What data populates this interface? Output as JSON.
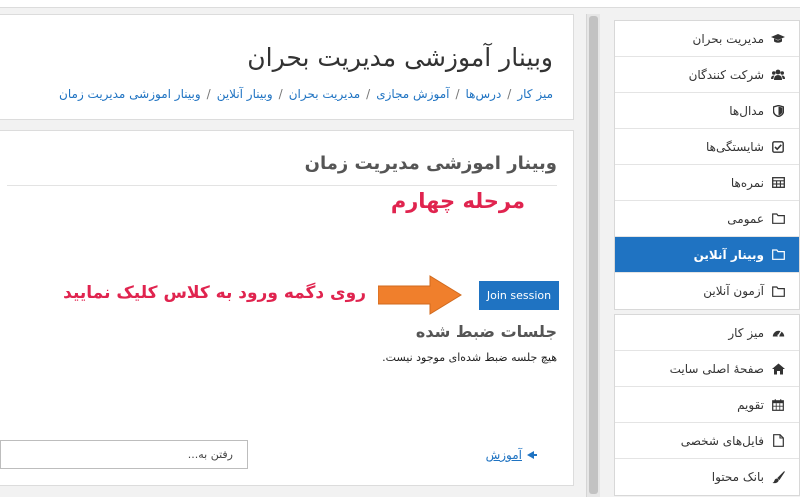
{
  "header": {
    "title": "وبینار آموزشی مدیریت بحران",
    "breadcrumb": [
      "میز کار",
      "درس‌ها",
      "آموزش مجازی",
      "مدیریت بحران",
      "وبینار آنلاین",
      "وبینار اموزشی مدیریت زمان"
    ]
  },
  "main": {
    "activity_title": "وبینار اموزشی مدیریت زمان",
    "stage_label": "مرحله چهارم",
    "join_button_label": "Join session",
    "instruction_text": "روی دگمه ورود به کلاس کلیک نمایید",
    "recordings_title": "جلسات ضبط شده",
    "recordings_empty": "هیچ جلسه ضبط شده‌ای موجود نیست.",
    "prev_link": "آموزش",
    "jump_placeholder": "رفتن به..."
  },
  "sidebar": {
    "course_items": [
      {
        "label": "مدیریت بحران",
        "icon": "graduation-cap-icon"
      },
      {
        "label": "شرکت کنندگان",
        "icon": "users-icon"
      },
      {
        "label": "مدال‌ها",
        "icon": "shield-icon"
      },
      {
        "label": "شایستگی‌ها",
        "icon": "checkbox-icon"
      },
      {
        "label": "نمره‌ها",
        "icon": "table-icon"
      },
      {
        "label": "عمومی",
        "icon": "folder-icon"
      },
      {
        "label": "وبینار آنلاین",
        "icon": "folder-icon",
        "active": true
      },
      {
        "label": "آزمون آنلاین",
        "icon": "folder-icon"
      }
    ],
    "site_items": [
      {
        "label": "میز کار",
        "icon": "dashboard-icon"
      },
      {
        "label": "صفحهٔ اصلی سایت",
        "icon": "home-icon"
      },
      {
        "label": "تقویم",
        "icon": "calendar-icon"
      },
      {
        "label": "فایل‌های شخصی",
        "icon": "file-icon"
      },
      {
        "label": "بانک محتوا",
        "icon": "brush-icon"
      }
    ]
  },
  "colors": {
    "accent": "#1f73c2",
    "highlight_text": "#e0244f",
    "arrow": "#f07f2c"
  }
}
